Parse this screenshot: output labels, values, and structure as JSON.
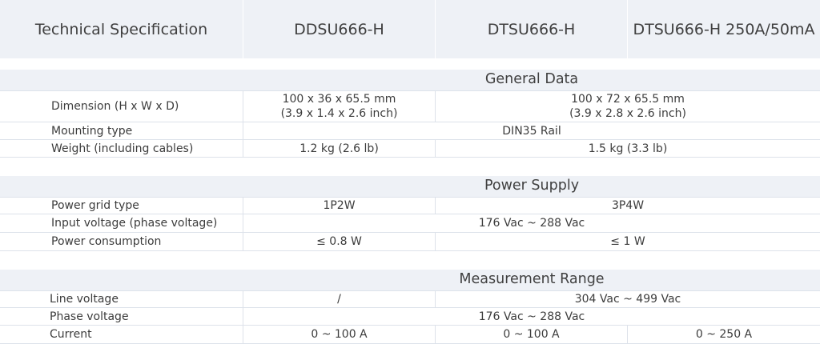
{
  "header": {
    "spec": "Technical Specification",
    "col1": "DDSU666-H",
    "col2": "DTSU666-H",
    "col3": "DTSU666-H 250A/50mA"
  },
  "sections": {
    "general": {
      "title": "General Data",
      "dimension": {
        "label": "Dimension (H x W x D)",
        "v1_line1": "100 x 36 x 65.5 mm",
        "v1_line2": "(3.9 x 1.4 x 2.6 inch)",
        "v2_line1": "100 x 72 x 65.5 mm",
        "v2_line2": "(3.9 x 2.8 x 2.6 inch)"
      },
      "mounting": {
        "label": "Mounting type",
        "value": "DIN35 Rail"
      },
      "weight": {
        "label": "Weight (including cables)",
        "v1": "1.2 kg (2.6 lb)",
        "v2": "1.5 kg (3.3 lb)"
      }
    },
    "power": {
      "title": "Power Supply",
      "grid": {
        "label": "Power grid type",
        "v1": "1P2W",
        "v2": "3P4W"
      },
      "input": {
        "label": "Input voltage (phase voltage)",
        "value": "176 Vac ~ 288 Vac"
      },
      "consumption": {
        "label": "Power consumption",
        "v1": "≤ 0.8 W",
        "v2": "≤ 1 W"
      }
    },
    "measurement": {
      "title": "Measurement Range",
      "line": {
        "label": "Line voltage",
        "v1": "/",
        "v2": "304 Vac ~ 499 Vac"
      },
      "phase": {
        "label": "Phase voltage",
        "value": "176 Vac ~ 288 Vac"
      },
      "current": {
        "label": "Current",
        "v1": "0 ~ 100 A",
        "v2": "0 ~ 100 A",
        "v3": "0 ~ 250 A"
      }
    }
  }
}
